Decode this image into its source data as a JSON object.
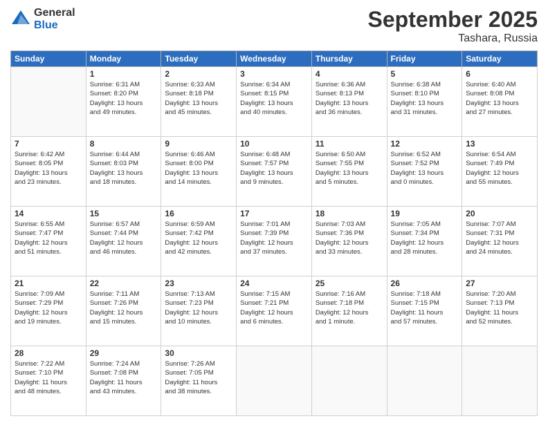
{
  "logo": {
    "general": "General",
    "blue": "Blue"
  },
  "title": {
    "month_year": "September 2025",
    "location": "Tashara, Russia"
  },
  "days_of_week": [
    "Sunday",
    "Monday",
    "Tuesday",
    "Wednesday",
    "Thursday",
    "Friday",
    "Saturday"
  ],
  "weeks": [
    [
      {
        "day": null,
        "info": null
      },
      {
        "day": "1",
        "info": "Sunrise: 6:31 AM\nSunset: 8:20 PM\nDaylight: 13 hours\nand 49 minutes."
      },
      {
        "day": "2",
        "info": "Sunrise: 6:33 AM\nSunset: 8:18 PM\nDaylight: 13 hours\nand 45 minutes."
      },
      {
        "day": "3",
        "info": "Sunrise: 6:34 AM\nSunset: 8:15 PM\nDaylight: 13 hours\nand 40 minutes."
      },
      {
        "day": "4",
        "info": "Sunrise: 6:36 AM\nSunset: 8:13 PM\nDaylight: 13 hours\nand 36 minutes."
      },
      {
        "day": "5",
        "info": "Sunrise: 6:38 AM\nSunset: 8:10 PM\nDaylight: 13 hours\nand 31 minutes."
      },
      {
        "day": "6",
        "info": "Sunrise: 6:40 AM\nSunset: 8:08 PM\nDaylight: 13 hours\nand 27 minutes."
      }
    ],
    [
      {
        "day": "7",
        "info": "Sunrise: 6:42 AM\nSunset: 8:05 PM\nDaylight: 13 hours\nand 23 minutes."
      },
      {
        "day": "8",
        "info": "Sunrise: 6:44 AM\nSunset: 8:03 PM\nDaylight: 13 hours\nand 18 minutes."
      },
      {
        "day": "9",
        "info": "Sunrise: 6:46 AM\nSunset: 8:00 PM\nDaylight: 13 hours\nand 14 minutes."
      },
      {
        "day": "10",
        "info": "Sunrise: 6:48 AM\nSunset: 7:57 PM\nDaylight: 13 hours\nand 9 minutes."
      },
      {
        "day": "11",
        "info": "Sunrise: 6:50 AM\nSunset: 7:55 PM\nDaylight: 13 hours\nand 5 minutes."
      },
      {
        "day": "12",
        "info": "Sunrise: 6:52 AM\nSunset: 7:52 PM\nDaylight: 13 hours\nand 0 minutes."
      },
      {
        "day": "13",
        "info": "Sunrise: 6:54 AM\nSunset: 7:49 PM\nDaylight: 12 hours\nand 55 minutes."
      }
    ],
    [
      {
        "day": "14",
        "info": "Sunrise: 6:55 AM\nSunset: 7:47 PM\nDaylight: 12 hours\nand 51 minutes."
      },
      {
        "day": "15",
        "info": "Sunrise: 6:57 AM\nSunset: 7:44 PM\nDaylight: 12 hours\nand 46 minutes."
      },
      {
        "day": "16",
        "info": "Sunrise: 6:59 AM\nSunset: 7:42 PM\nDaylight: 12 hours\nand 42 minutes."
      },
      {
        "day": "17",
        "info": "Sunrise: 7:01 AM\nSunset: 7:39 PM\nDaylight: 12 hours\nand 37 minutes."
      },
      {
        "day": "18",
        "info": "Sunrise: 7:03 AM\nSunset: 7:36 PM\nDaylight: 12 hours\nand 33 minutes."
      },
      {
        "day": "19",
        "info": "Sunrise: 7:05 AM\nSunset: 7:34 PM\nDaylight: 12 hours\nand 28 minutes."
      },
      {
        "day": "20",
        "info": "Sunrise: 7:07 AM\nSunset: 7:31 PM\nDaylight: 12 hours\nand 24 minutes."
      }
    ],
    [
      {
        "day": "21",
        "info": "Sunrise: 7:09 AM\nSunset: 7:29 PM\nDaylight: 12 hours\nand 19 minutes."
      },
      {
        "day": "22",
        "info": "Sunrise: 7:11 AM\nSunset: 7:26 PM\nDaylight: 12 hours\nand 15 minutes."
      },
      {
        "day": "23",
        "info": "Sunrise: 7:13 AM\nSunset: 7:23 PM\nDaylight: 12 hours\nand 10 minutes."
      },
      {
        "day": "24",
        "info": "Sunrise: 7:15 AM\nSunset: 7:21 PM\nDaylight: 12 hours\nand 6 minutes."
      },
      {
        "day": "25",
        "info": "Sunrise: 7:16 AM\nSunset: 7:18 PM\nDaylight: 12 hours\nand 1 minute."
      },
      {
        "day": "26",
        "info": "Sunrise: 7:18 AM\nSunset: 7:15 PM\nDaylight: 11 hours\nand 57 minutes."
      },
      {
        "day": "27",
        "info": "Sunrise: 7:20 AM\nSunset: 7:13 PM\nDaylight: 11 hours\nand 52 minutes."
      }
    ],
    [
      {
        "day": "28",
        "info": "Sunrise: 7:22 AM\nSunset: 7:10 PM\nDaylight: 11 hours\nand 48 minutes."
      },
      {
        "day": "29",
        "info": "Sunrise: 7:24 AM\nSunset: 7:08 PM\nDaylight: 11 hours\nand 43 minutes."
      },
      {
        "day": "30",
        "info": "Sunrise: 7:26 AM\nSunset: 7:05 PM\nDaylight: 11 hours\nand 38 minutes."
      },
      {
        "day": null,
        "info": null
      },
      {
        "day": null,
        "info": null
      },
      {
        "day": null,
        "info": null
      },
      {
        "day": null,
        "info": null
      }
    ]
  ]
}
